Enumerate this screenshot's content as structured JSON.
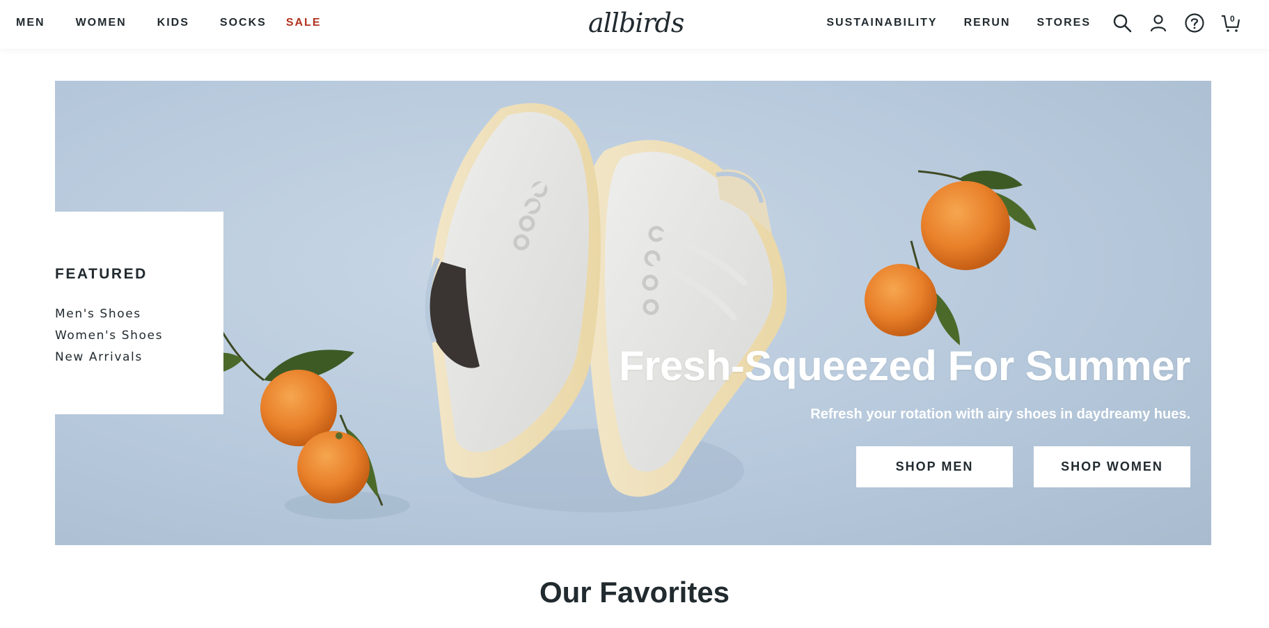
{
  "header": {
    "nav_left": [
      {
        "label": "MEN"
      },
      {
        "label": "WOMEN"
      },
      {
        "label": "KIDS"
      },
      {
        "label": "SOCKS"
      },
      {
        "label": "SALE",
        "color": "#b0321f"
      }
    ],
    "logo": "allbirds",
    "nav_right": [
      {
        "label": "SUSTAINABILITY"
      },
      {
        "label": "RERUN"
      },
      {
        "label": "STORES"
      }
    ],
    "icons": [
      "search-icon",
      "account-icon",
      "help-icon",
      "cart-icon"
    ],
    "cart_count": "0"
  },
  "hero": {
    "featured": {
      "title": "FEATURED",
      "links": [
        "Men's Shoes",
        "Women's Shoes",
        "New Arrivals"
      ]
    },
    "headline": "Fresh-Squeezed For Summer",
    "subheadline": "Refresh your rotation with airy shoes in daydreamy hues.",
    "buttons": [
      "SHOP MEN",
      "SHOP WOMEN"
    ]
  },
  "sections": {
    "favorites_title": "Our Favorites"
  },
  "colors": {
    "text": "#212a2f",
    "sale": "#b0321f",
    "hero_bg": "#b7c9dc"
  }
}
